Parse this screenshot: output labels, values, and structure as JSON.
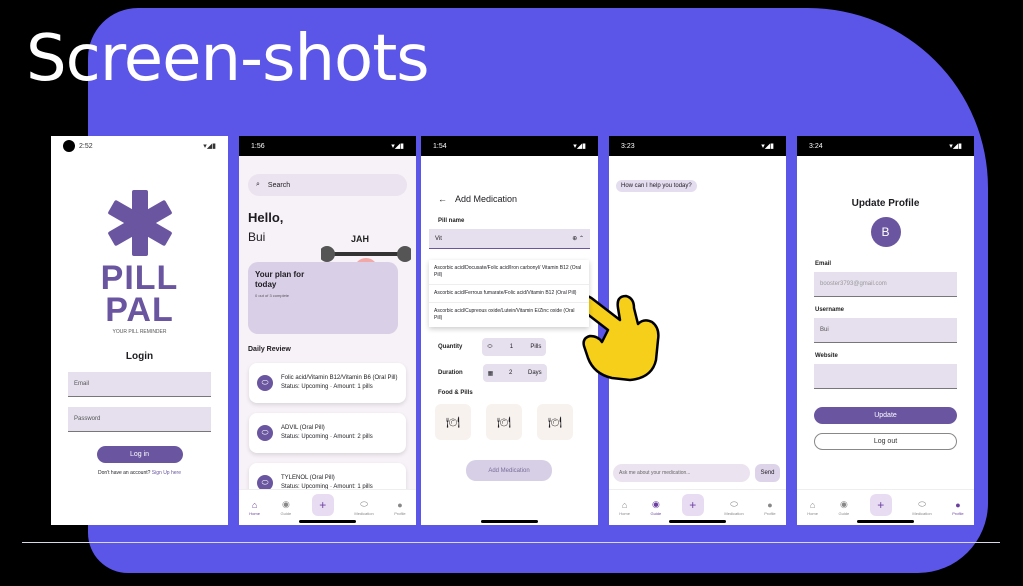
{
  "header": {
    "title": "Screen-shots"
  },
  "colors": {
    "accent": "#6a55a0",
    "blob": "#5b55e8",
    "hand": "#f5cf1a"
  },
  "screen1": {
    "time": "2:52",
    "logo_line1": "PILL",
    "logo_line2": "PAL",
    "tagline": "YOUR PILL REMINDER",
    "heading": "Login",
    "email_placeholder": "Email",
    "password_placeholder": "Password",
    "login_btn": "Log in",
    "no_account": "Don't have an account?",
    "signup": "Sign Up here"
  },
  "screen2": {
    "time": "1:56",
    "search": "Search",
    "hello": "Hello,",
    "name": "Bui",
    "plan_title": "Your plan for today",
    "plan_sub": "0 out of 3 complete",
    "daily_review": "Daily Review",
    "cards": [
      {
        "name": "Folic acid/Vitamin B12/Vitamin B6 (Oral Pill)",
        "status": "Status: Upcoming · Amount: 1 pills"
      },
      {
        "name": "ADVIL (Oral Pill)",
        "status": "Status: Upcoming · Amount: 2 pills"
      },
      {
        "name": "TYLENOL (Oral Pill)",
        "status": "Status: Upcoming · Amount: 1 pills"
      }
    ],
    "nav": [
      "Home",
      "Guide",
      "",
      "Medication",
      "Profile"
    ]
  },
  "screen3": {
    "time": "1:54",
    "title": "Add Medication",
    "pill_name_label": "Pill name",
    "pill_value": "Vit",
    "options": [
      "Ascorbic acid/Docusate/Folic acid/Iron carbonyl/ Vitamin B12 (Oral Pill)",
      "Ascorbic acid/Ferrous fumarate/Folic acid/Vitamin B12 (Oral Pill)",
      "Ascorbic acid/Cupreous oxide/Lutein/Vitamin E/Zinc oxide (Oral Pill)"
    ],
    "quantity_label": "Quantity",
    "quantity_value": "1",
    "quantity_unit": "Pills",
    "duration_label": "Duration",
    "duration_value": "2",
    "duration_unit": "Days",
    "food_label": "Food & Pills",
    "add_btn": "Add Medication"
  },
  "screen4": {
    "time": "3:23",
    "bubble": "How can I help you today?",
    "input_placeholder": "Ask me about your medication...",
    "send": "Send"
  },
  "screen5": {
    "time": "3:24",
    "title": "Update Profile",
    "avatar": "B",
    "email_label": "Email",
    "email_value": "booster3793@gmail.com",
    "username_label": "Username",
    "username_value": "Bui",
    "website_label": "Website",
    "website_value": "",
    "update_btn": "Update",
    "logout_btn": "Log out"
  },
  "nav_labels": {
    "home": "Home",
    "guide": "Guide",
    "medication": "Medication",
    "profile": "Profile"
  }
}
